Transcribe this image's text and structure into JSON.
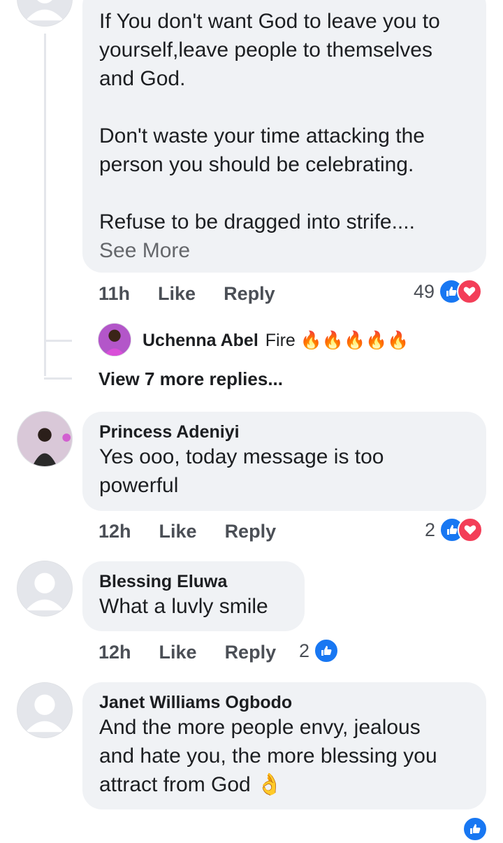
{
  "comments": [
    {
      "author": "",
      "text": "If You don't want God to leave you to\nyourself,leave people to themselves\nand God.\n\nDon't waste your time attacking the\nperson you should be celebrating.\n\nRefuse to be dragged into strife....",
      "see_more": "See More",
      "time": "11h",
      "like": "Like",
      "reply": "Reply",
      "reaction_count": "49",
      "reactions": [
        "like-icon",
        "love-icon"
      ]
    },
    {
      "author": "Princess Adeniyi",
      "text": "Yes ooo, today message is too\npowerful",
      "time": "12h",
      "like": "Like",
      "reply": "Reply",
      "reaction_count": "2",
      "reactions": [
        "like-icon",
        "love-icon"
      ]
    },
    {
      "author": "Blessing Eluwa",
      "text": "What a luvly smile",
      "time": "12h",
      "like": "Like",
      "reply": "Reply",
      "reaction_count": "2",
      "reactions": [
        "like-icon"
      ]
    },
    {
      "author": "Janet Williams Ogbodo",
      "text": "And the more people envy, jealous\nand hate you, the more blessing you\nattract from God 👌",
      "time": "",
      "like": "",
      "reply": "",
      "reaction_count": "",
      "reactions": [
        "like-icon"
      ]
    }
  ],
  "reply_preview": {
    "author": "Uchenna Abel",
    "text": "Fire 🔥🔥🔥🔥🔥"
  },
  "view_more_replies": "View 7 more replies...",
  "colors": {
    "bubble": "#f0f2f5",
    "like": "#1877f2",
    "love": "#f33e58"
  }
}
